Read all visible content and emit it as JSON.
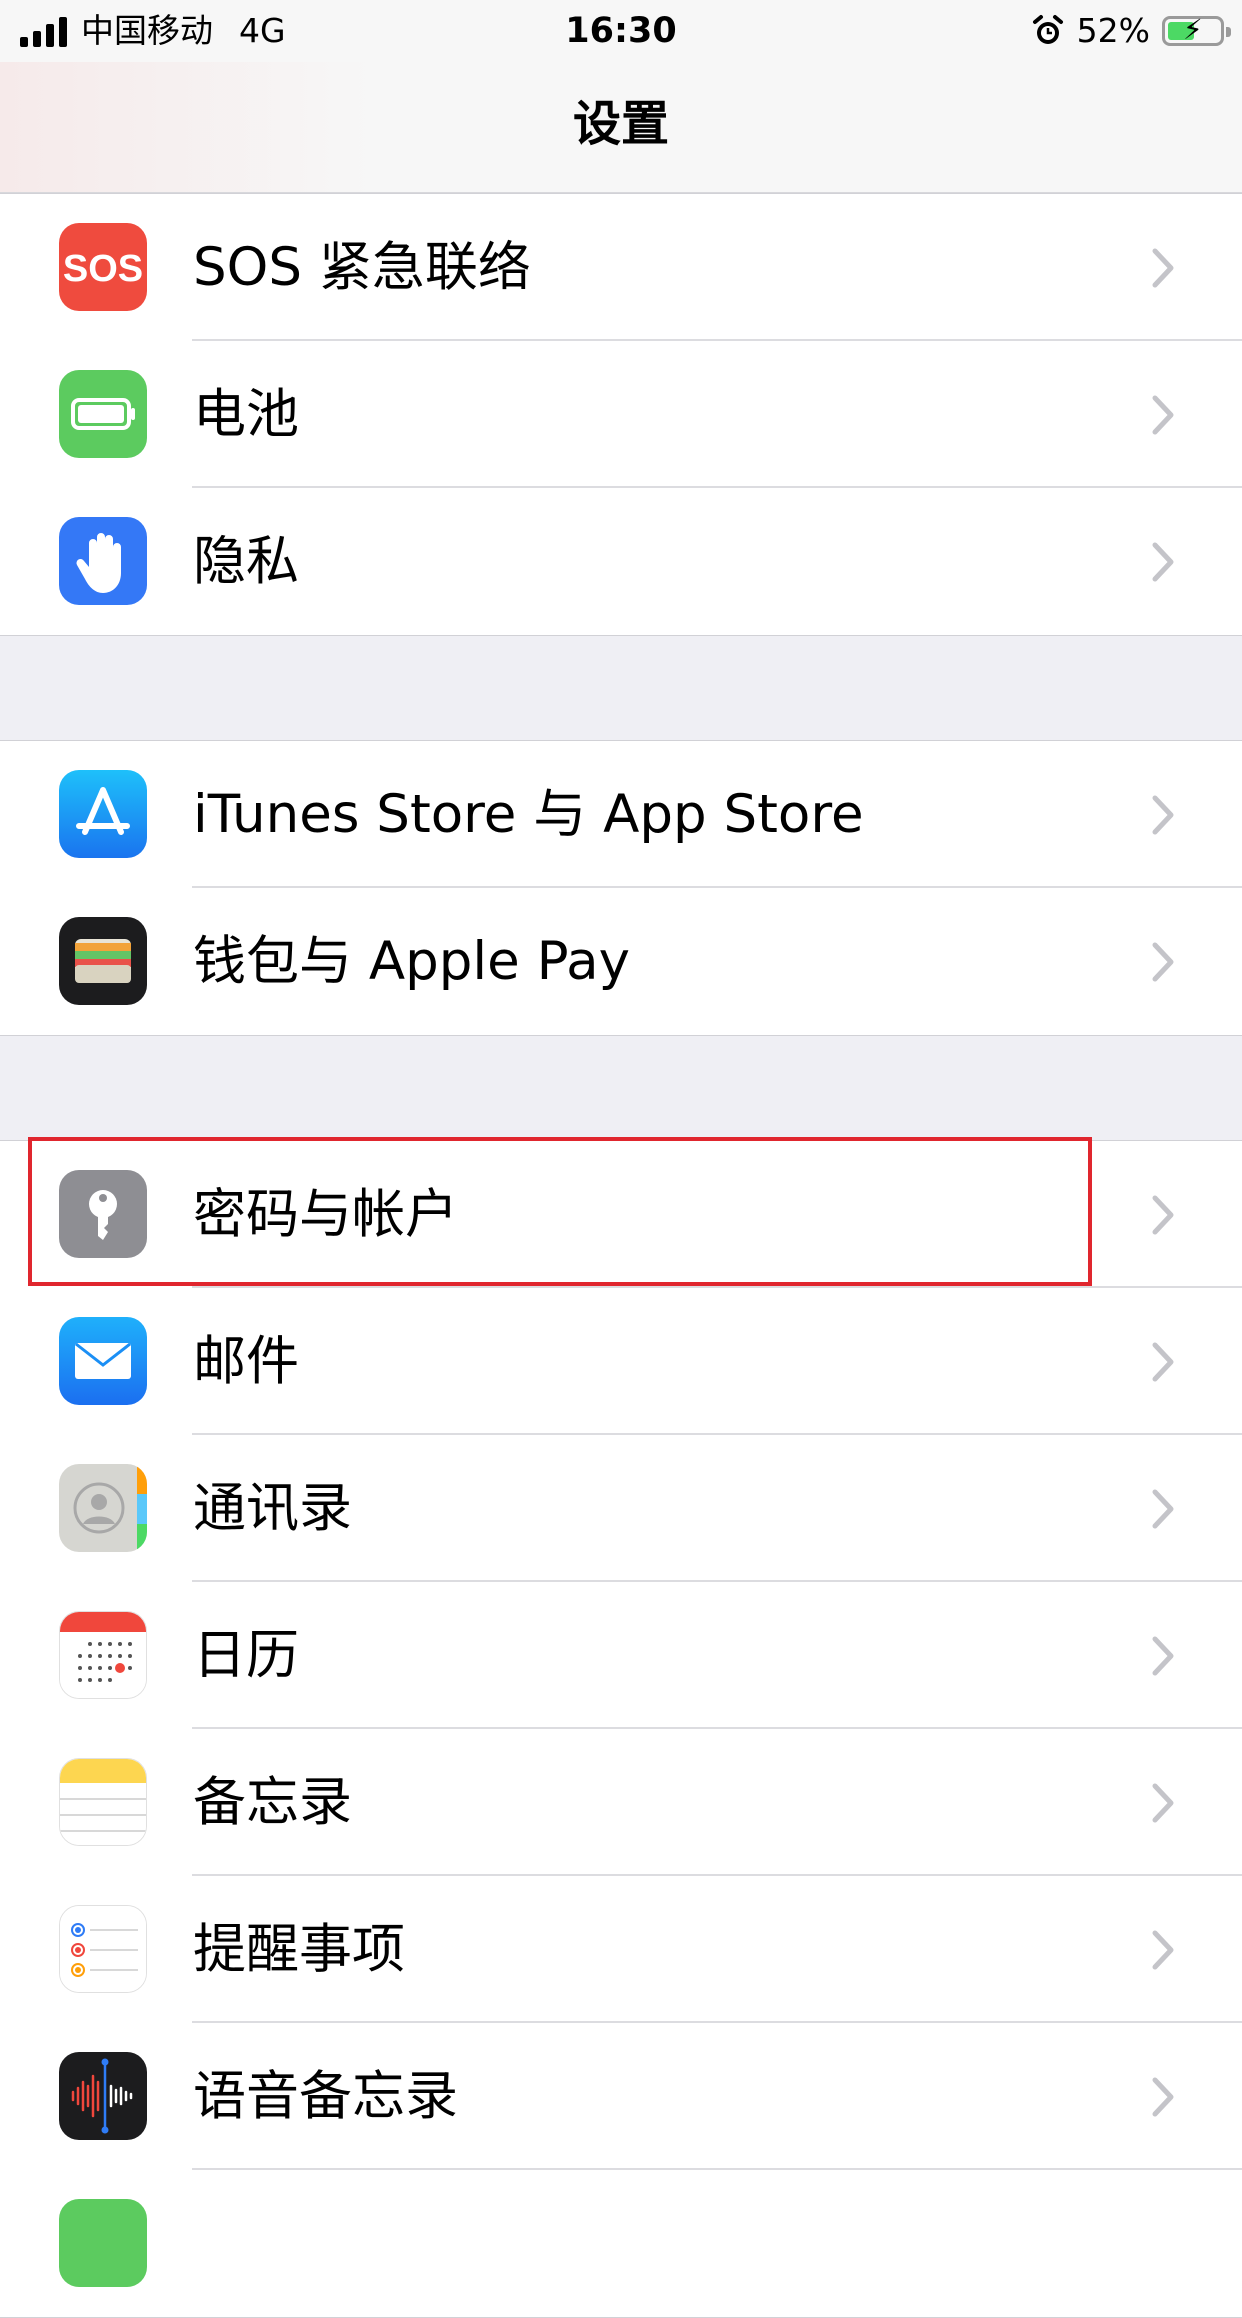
{
  "status": {
    "carrier": "中国移动",
    "network": "4G",
    "time": "16:30",
    "battery_percent_label": "52%",
    "battery_level": 0.52,
    "icons": [
      "signal-icon",
      "alarm-icon",
      "battery-charging-icon"
    ]
  },
  "nav": {
    "title": "设置"
  },
  "groups": [
    {
      "items": [
        {
          "label": "SOS 紧急联络",
          "icon": "sos-icon",
          "color": "#ef4b3e"
        },
        {
          "label": "电池",
          "icon": "battery-icon",
          "color": "#5ccb5f"
        },
        {
          "label": "隐私",
          "icon": "hand-icon",
          "color": "#3478f6"
        }
      ]
    },
    {
      "items": [
        {
          "label": "iTunes Store 与 App Store",
          "icon": "app-store-icon",
          "color": "#2f8cf5"
        },
        {
          "label": "钱包与 Apple Pay",
          "icon": "wallet-icon",
          "color": "#1c1c1e"
        }
      ]
    },
    {
      "items": [
        {
          "label": "密码与帐户",
          "icon": "key-icon",
          "color": "#8e8e93"
        },
        {
          "label": "邮件",
          "icon": "mail-icon",
          "color": "#2f8cf5"
        },
        {
          "label": "通讯录",
          "icon": "contacts-icon",
          "color": "#d6d6d1"
        },
        {
          "label": "日历",
          "icon": "calendar-icon",
          "color": "#ffffff"
        },
        {
          "label": "备忘录",
          "icon": "notes-icon",
          "color": "#ffffff"
        },
        {
          "label": "提醒事项",
          "icon": "reminders-icon",
          "color": "#ffffff"
        },
        {
          "label": "语音备忘录",
          "icon": "voice-memos-icon",
          "color": "#1c1c1e"
        }
      ]
    }
  ],
  "highlight_color": "#e0262e"
}
